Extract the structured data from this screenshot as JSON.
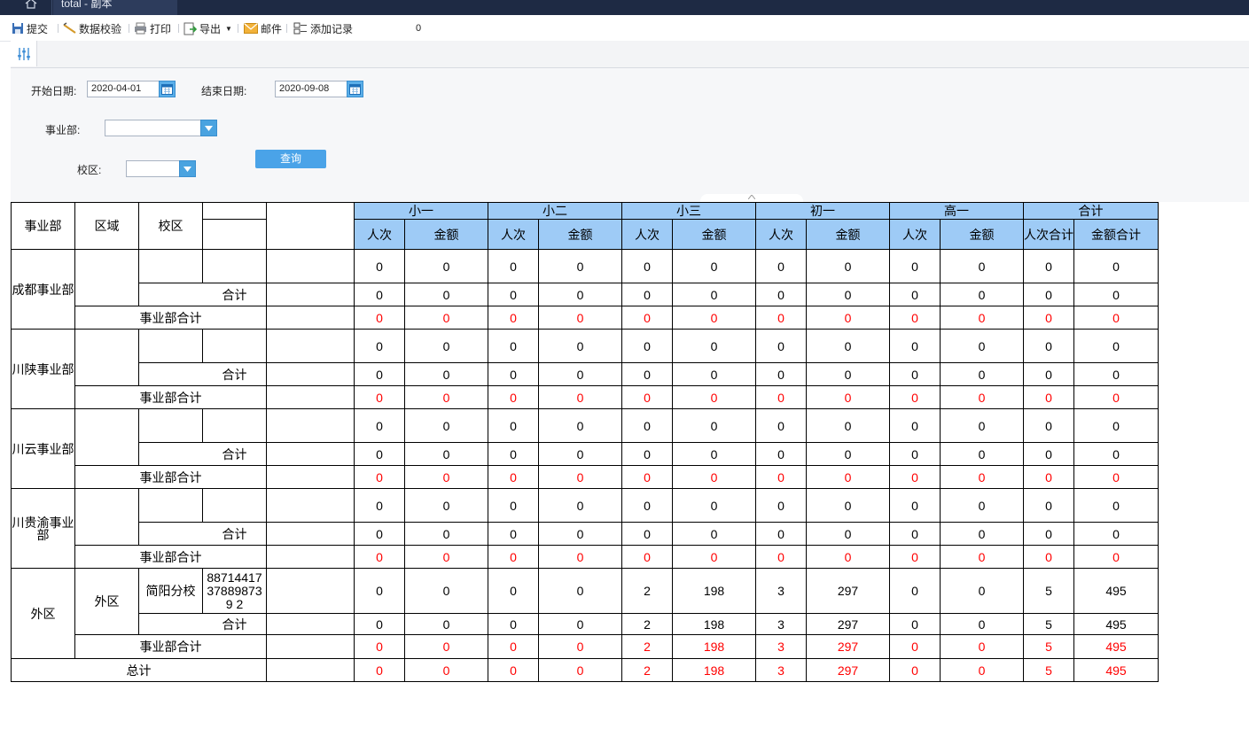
{
  "tabs": {
    "doc_title": "total - 副本"
  },
  "toolbar": {
    "submit": "提交",
    "validate": "数据校验",
    "print": "打印",
    "export": "导出",
    "mail": "邮件",
    "add_record": "添加记录",
    "record_count": "0"
  },
  "params": {
    "start_label": "开始日期:",
    "start_value": "2020-04-01",
    "end_label": "结束日期:",
    "end_value": "2020-09-08",
    "division_label": "事业部:",
    "division_value": "",
    "campus_label": "校区:",
    "campus_value": "",
    "query_label": "查询"
  },
  "report": {
    "header": {
      "division": "事业部",
      "region": "区域",
      "campus": "校区",
      "grades": [
        "小一",
        "小二",
        "小三",
        "初一",
        "高一"
      ],
      "total": "合计",
      "count": "人次",
      "amount": "金额",
      "count_total": "人次合计",
      "amount_total": "金额合计"
    },
    "labels": {
      "subtotal": "合计",
      "division_total": "事业部合计",
      "grand_total": "总计"
    },
    "divisions": [
      {
        "name": "成都事业部",
        "region": "",
        "row": {
          "campus": "",
          "code": "",
          "values": [
            "0",
            "0",
            "0",
            "0",
            "0",
            "0",
            "0",
            "0",
            "0",
            "0",
            "0",
            "0"
          ]
        },
        "subtotal": [
          "0",
          "0",
          "0",
          "0",
          "0",
          "0",
          "0",
          "0",
          "0",
          "0",
          "0",
          "0"
        ],
        "division_total": [
          "0",
          "0",
          "0",
          "0",
          "0",
          "0",
          "0",
          "0",
          "0",
          "0",
          "0",
          "0"
        ]
      },
      {
        "name": "川陕事业部",
        "region": "",
        "row": {
          "campus": "",
          "code": "",
          "values": [
            "0",
            "0",
            "0",
            "0",
            "0",
            "0",
            "0",
            "0",
            "0",
            "0",
            "0",
            "0"
          ]
        },
        "subtotal": [
          "0",
          "0",
          "0",
          "0",
          "0",
          "0",
          "0",
          "0",
          "0",
          "0",
          "0",
          "0"
        ],
        "division_total": [
          "0",
          "0",
          "0",
          "0",
          "0",
          "0",
          "0",
          "0",
          "0",
          "0",
          "0",
          "0"
        ]
      },
      {
        "name": "川云事业部",
        "region": "",
        "row": {
          "campus": "",
          "code": "",
          "values": [
            "0",
            "0",
            "0",
            "0",
            "0",
            "0",
            "0",
            "0",
            "0",
            "0",
            "0",
            "0"
          ]
        },
        "subtotal": [
          "0",
          "0",
          "0",
          "0",
          "0",
          "0",
          "0",
          "0",
          "0",
          "0",
          "0",
          "0"
        ],
        "division_total": [
          "0",
          "0",
          "0",
          "0",
          "0",
          "0",
          "0",
          "0",
          "0",
          "0",
          "0",
          "0"
        ]
      },
      {
        "name": "川贵渝事业部",
        "region": "",
        "row": {
          "campus": "",
          "code": "",
          "values": [
            "0",
            "0",
            "0",
            "0",
            "0",
            "0",
            "0",
            "0",
            "0",
            "0",
            "0",
            "0"
          ]
        },
        "subtotal": [
          "0",
          "0",
          "0",
          "0",
          "0",
          "0",
          "0",
          "0",
          "0",
          "0",
          "0",
          "0"
        ],
        "division_total": [
          "0",
          "0",
          "0",
          "0",
          "0",
          "0",
          "0",
          "0",
          "0",
          "0",
          "0",
          "0"
        ]
      },
      {
        "name": "外区",
        "region": "外区",
        "row": {
          "campus": "简阳分校",
          "code": "88714417378898739 2",
          "values": [
            "0",
            "0",
            "0",
            "0",
            "2",
            "198",
            "3",
            "297",
            "0",
            "0",
            "5",
            "495"
          ]
        },
        "subtotal": [
          "0",
          "0",
          "0",
          "0",
          "2",
          "198",
          "3",
          "297",
          "0",
          "0",
          "5",
          "495"
        ],
        "division_total": [
          "0",
          "0",
          "0",
          "0",
          "2",
          "198",
          "3",
          "297",
          "0",
          "0",
          "5",
          "495"
        ]
      }
    ],
    "grand_total": [
      "0",
      "0",
      "0",
      "0",
      "2",
      "198",
      "3",
      "297",
      "0",
      "0",
      "5",
      "495"
    ]
  },
  "colors": {
    "header_fill": "#9ecbf6",
    "total_text": "#ff0000",
    "topbar": "#1e2a44",
    "accent": "#4aa3e8"
  },
  "icons": [
    "home-icon",
    "save-icon",
    "validate-icon",
    "print-icon",
    "export-icon",
    "mail-icon",
    "add-record-icon",
    "filter-panel-icon",
    "calendar-icon",
    "dropdown-arrow-icon"
  ]
}
